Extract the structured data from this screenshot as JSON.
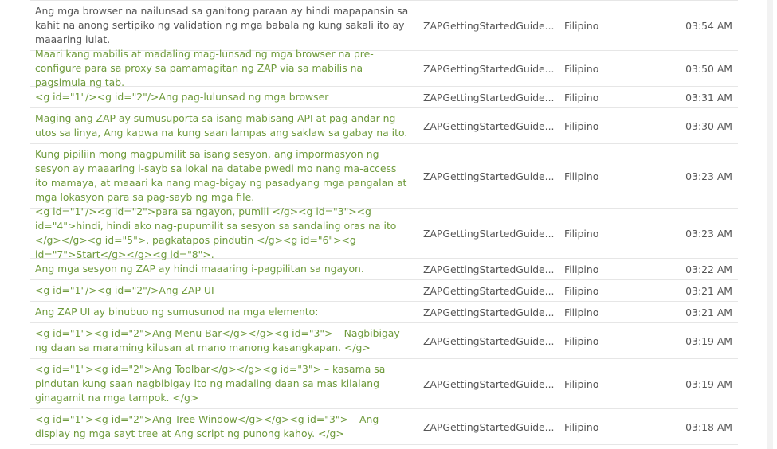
{
  "rows": [
    {
      "text": "Ang mga browser na nailunsad sa ganitong paraan ay hindi mapapansin sa kahit na anong sertipiko ng validation ng mga babala ng kung sakali ito ay maaaring iulat.",
      "file": "ZAPGettingStartedGuide....",
      "language": "Filipino",
      "time": "03:54 AM",
      "style": "dark"
    },
    {
      "text": "Maari kang mabilis at madaling mag-lunsad ng mga browser na pre-configure para sa proxy sa pamamagitan ng ZAP via sa mabilis na pagsimula ng tab.",
      "file": "ZAPGettingStartedGuide....",
      "language": "Filipino",
      "time": "03:50 AM",
      "style": "green"
    },
    {
      "text": "<g id=\"1\"/><g id=\"2\"/>Ang pag-lulunsad ng mga browser",
      "file": "ZAPGettingStartedGuide....",
      "language": "Filipino",
      "time": "03:31 AM",
      "style": "green"
    },
    {
      "text": "Maging ang ZAP ay sumusuporta sa isang mabisang API at pag-andar ng utos sa linya, Ang kapwa na kung saan lampas ang saklaw sa gabay na ito.",
      "file": "ZAPGettingStartedGuide....",
      "language": "Filipino",
      "time": "03:30 AM",
      "style": "green"
    },
    {
      "text": "Kung pipiliin mong magpumilit sa isang sesyon, ang impormasyon ng sesyon ay maaaring i-sayb sa lokal na databe pwedi mo nang ma-access ito mamaya, at maaari ka nang mag-bigay ng pasadyang mga pangalan at mga lokasyon para sa pag-sayb ng mga file.",
      "file": "ZAPGettingStartedGuide....",
      "language": "Filipino",
      "time": "03:23 AM",
      "style": "green"
    },
    {
      "text": "<g id=\"1\"/><g id=\"2\">para sa ngayon, pumili </g><g id=\"3\"><g id=\"4\">hindi, hindi ako nag-pupumilit sa sesyon sa sandaling oras na ito </g></g><g id=\"5\">, pagkatapos pindutin </g><g id=\"6\"><g id=\"7\">Start</g></g><g id=\"8\">.",
      "file": "ZAPGettingStartedGuide....",
      "language": "Filipino",
      "time": "03:23 AM",
      "style": "green"
    },
    {
      "text": "Ang mga sesyon ng ZAP ay hindi maaaring i-pagpilitan sa ngayon.",
      "file": "ZAPGettingStartedGuide....",
      "language": "Filipino",
      "time": "03:22 AM",
      "style": "green"
    },
    {
      "text": "<g id=\"1\"/><g id=\"2\"/>Ang ZAP UI",
      "file": "ZAPGettingStartedGuide....",
      "language": "Filipino",
      "time": "03:21 AM",
      "style": "green"
    },
    {
      "text": "Ang ZAP UI ay binubuo ng sumusunod na mga elemento:",
      "file": "ZAPGettingStartedGuide....",
      "language": "Filipino",
      "time": "03:21 AM",
      "style": "green"
    },
    {
      "text": "<g id=\"1\"><g id=\"2\">Ang Menu Bar</g></g><g id=\"3\"> – Nagbibigay ng daan sa maraming kilusan at mano manong kasangkapan. </g>",
      "file": "ZAPGettingStartedGuide....",
      "language": "Filipino",
      "time": "03:19 AM",
      "style": "green"
    },
    {
      "text": "<g id=\"1\"><g id=\"2\">Ang Toolbar</g></g><g id=\"3\"> – kasama sa pindutan kung saan nagbibigay ito ng madaling daan sa mas kilalang ginagamit na mga tampok. </g>",
      "file": "ZAPGettingStartedGuide....",
      "language": "Filipino",
      "time": "03:19 AM",
      "style": "green"
    },
    {
      "text": "<g id=\"1\"><g id=\"2\">Ang Tree Window</g></g><g id=\"3\"> – Ang display ng mga sayt tree at Ang script ng punong kahoy. </g>",
      "file": "ZAPGettingStartedGuide....",
      "language": "Filipino",
      "time": "03:18 AM",
      "style": "green"
    }
  ]
}
